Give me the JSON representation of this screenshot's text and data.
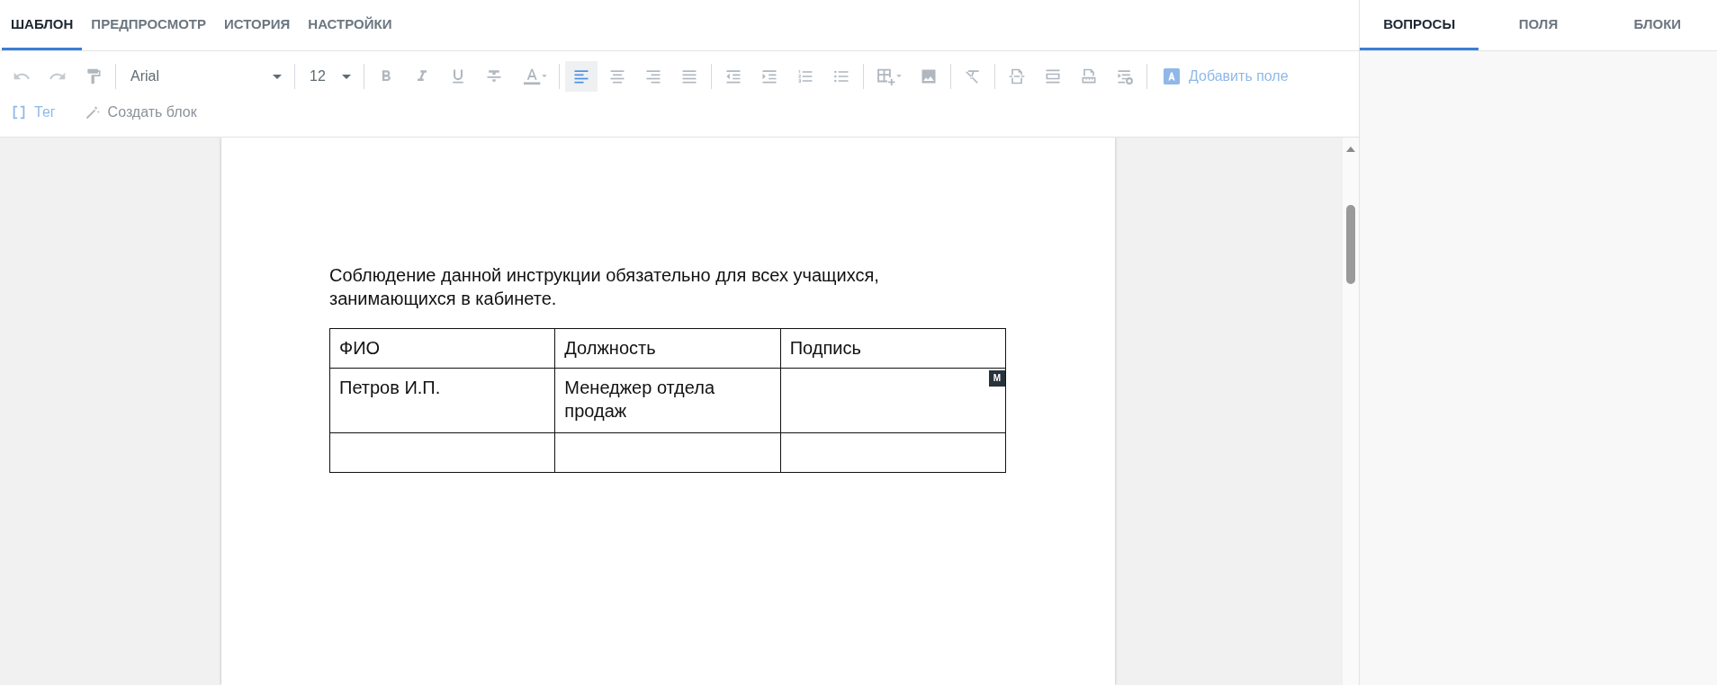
{
  "editor_tabs": [
    {
      "label": "ШАБЛОН",
      "selected": true
    },
    {
      "label": "ПРЕДПРОСМОТР",
      "selected": false
    },
    {
      "label": "ИСТОРИЯ",
      "selected": false
    },
    {
      "label": "НАСТРОЙКИ",
      "selected": false
    }
  ],
  "toolbar": {
    "font": "Arial",
    "size": "12",
    "align_buttons": [
      {
        "selected": true
      },
      {
        "selected": false
      },
      {
        "selected": false
      },
      {
        "selected": false
      }
    ],
    "add_field": "Добавить поле",
    "tag": "Тег",
    "create_block": "Создать блок"
  },
  "document": {
    "paragraph": "Соблюдение данной инструкции обязательно для всех учащихся, занимающихся в кабинете.",
    "table": {
      "columns": [
        "ФИО",
        "Должность",
        "Подпись"
      ],
      "rows": [
        {
          "cells": [
            "Петров И.П.",
            "Менеджер отдела продаж",
            ""
          ],
          "badge": "M"
        },
        {
          "cells": [
            "",
            "",
            ""
          ]
        }
      ]
    }
  },
  "side_tabs": [
    {
      "label": "ВОПРОСЫ",
      "selected": true
    },
    {
      "label": "ПОЛЯ",
      "selected": false
    },
    {
      "label": "БЛОКИ",
      "selected": false
    }
  ]
}
